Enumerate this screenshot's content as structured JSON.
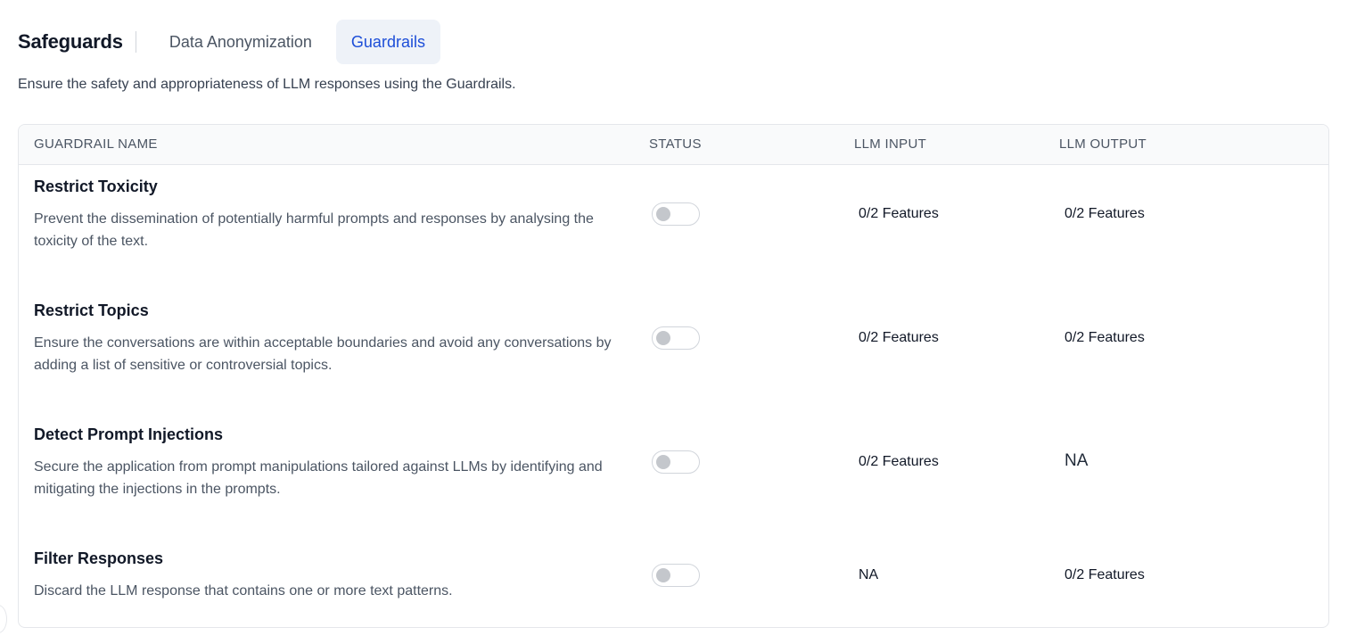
{
  "header": {
    "title": "Safeguards",
    "tabs": [
      {
        "label": "Data Anonymization",
        "active": false
      },
      {
        "label": "Guardrails",
        "active": true
      }
    ]
  },
  "subtitle": "Ensure the safety and appropriateness of LLM responses using the Guardrails.",
  "table": {
    "columns": [
      "GUARDRAIL NAME",
      "STATUS",
      "LLM INPUT",
      "LLM OUTPUT"
    ],
    "rows": [
      {
        "name": "Restrict Toxicity",
        "description": "Prevent the dissemination of potentially harmful prompts and responses by analysing the toxicity of the text.",
        "status_enabled": false,
        "llm_input": "0/2 Features",
        "llm_output": "0/2 Features"
      },
      {
        "name": "Restrict Topics",
        "description": "Ensure the conversations are within acceptable boundaries and avoid any conversations by adding a list of sensitive or controversial topics.",
        "status_enabled": false,
        "llm_input": "0/2 Features",
        "llm_output": "0/2 Features"
      },
      {
        "name": "Detect Prompt Injections",
        "description": "Secure the application from prompt manipulations tailored against LLMs by identifying and mitigating the injections in the prompts.",
        "status_enabled": false,
        "llm_input": "0/2 Features",
        "llm_output": "NA"
      },
      {
        "name": "Filter Responses",
        "description": "Discard the LLM response that contains one or more text patterns.",
        "status_enabled": false,
        "llm_input": "NA",
        "llm_output": "0/2 Features"
      }
    ]
  },
  "colors": {
    "accent": "#1d4ed8",
    "active_tab_bg": "#eef2f8",
    "header_bg": "#f9fafb",
    "toggle_knob": "#c4c7cc"
  }
}
